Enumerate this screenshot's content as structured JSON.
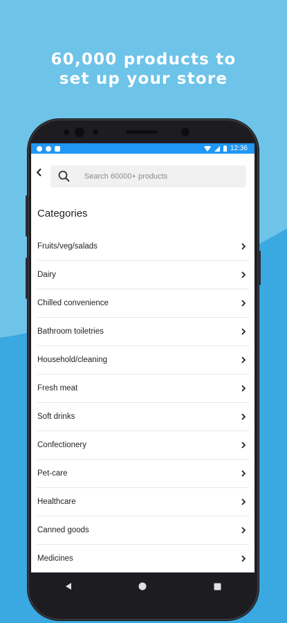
{
  "promo": {
    "headline_line1": "60,000 products to",
    "headline_line2": "set up your store"
  },
  "status_bar": {
    "time": "12:36"
  },
  "search": {
    "placeholder": "Search 60000+ products"
  },
  "categories": {
    "title": "Categories",
    "items": [
      {
        "label": "Fruits/veg/salads"
      },
      {
        "label": "Dairy"
      },
      {
        "label": "Chilled convenience"
      },
      {
        "label": "Bathroom toiletries"
      },
      {
        "label": "Household/cleaning"
      },
      {
        "label": "Fresh meat"
      },
      {
        "label": "Soft drinks"
      },
      {
        "label": "Confectionery"
      },
      {
        "label": "Pet-care"
      },
      {
        "label": "Healthcare"
      },
      {
        "label": "Canned goods"
      },
      {
        "label": "Medicines"
      }
    ]
  },
  "colors": {
    "background_light": "#6ec3e8",
    "background_dark": "#3aa8e1",
    "status_bar": "#2196f3"
  },
  "icons": {
    "back": "chevron-left-icon",
    "search": "search-icon",
    "row_chevron": "chevron-right-icon",
    "nav": [
      "back-triangle-icon",
      "home-circle-icon",
      "recents-square-icon"
    ]
  }
}
